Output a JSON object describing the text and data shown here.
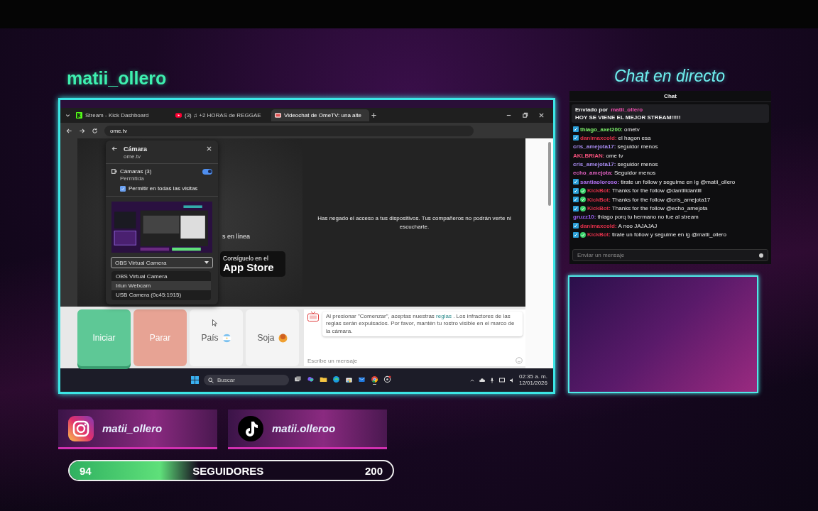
{
  "overlay": {
    "channel_name": "matii_ollero",
    "chat_heading": "Chat en directo"
  },
  "browser": {
    "tabs": [
      {
        "kind": "kick",
        "label": "Stream - Kick Dashboard",
        "selected": false
      },
      {
        "kind": "youtube",
        "label": "(3) ♫ +2 HORAS de REGGAE",
        "selected": false
      },
      {
        "kind": "ometv",
        "label": "Videochat de OmeTV: una alte",
        "selected": true
      }
    ],
    "address": "ome.tv",
    "page": {
      "online_text": "s en línea",
      "store_top": "Consíguelo en el",
      "store_name": "App Store",
      "denied_message": "Has negado el acceso a tus dispositivos. Tus compañeros no podrán verte ni escucharte.",
      "buttons": [
        {
          "kind": "start",
          "label": "Iniciar"
        },
        {
          "kind": "stop",
          "label": "Parar"
        },
        {
          "kind": "country",
          "label": "País"
        },
        {
          "kind": "gender",
          "label": "Soja"
        }
      ],
      "notice": {
        "before": "Al presionar \"Comenzar\", aceptas nuestras",
        "link": "reglas",
        "after": ". Los infractores de las reglas serán expulsados. Por favor, mantén tu rostro visible en el marco de la cámara."
      },
      "message_placeholder": "Escribe un mensaje"
    },
    "camera_popup": {
      "title": "Cámara",
      "site": "ome.tv",
      "permission_label": "Cámaras (3)",
      "permission_status": "Permitida",
      "on": true,
      "always_allow": {
        "label": "Permitir en todas las visitas",
        "checked": true
      },
      "select_value": "OBS Virtual Camera",
      "options": [
        {
          "label": "OBS Virtual Camera",
          "selected": false
        },
        {
          "label": "Iriun Webcam",
          "selected": true
        },
        {
          "label": "USB Camera (0c45:1915)",
          "selected": false
        }
      ]
    },
    "taskbar": {
      "search_placeholder": "Buscar",
      "apps": [
        {
          "kind": "taskview",
          "active": false
        },
        {
          "kind": "copilot",
          "active": false
        },
        {
          "kind": "files",
          "active": false
        },
        {
          "kind": "edge",
          "active": false
        },
        {
          "kind": "store",
          "active": false
        },
        {
          "kind": "mail",
          "active": false
        },
        {
          "kind": "chrome",
          "active": true
        },
        {
          "kind": "obs",
          "active": false
        }
      ],
      "time": "02:35 a. m.",
      "date": "12/01/2026"
    }
  },
  "chat": {
    "title": "Chat",
    "pinned": {
      "label": "Enviado por",
      "author": "matii_ollero",
      "text": "HOY SE VIENE EL MEJOR STREAM!!!!!"
    },
    "messages": [
      {
        "mod": true,
        "verified": false,
        "user": "thiago_axel200:",
        "color": "#7cf06a",
        "text": "ometv"
      },
      {
        "mod": true,
        "verified": false,
        "user": "danimaxcold:",
        "color": "#e0304a",
        "text": "el hagon esa"
      },
      {
        "mod": false,
        "verified": false,
        "user": "cris_amejota17:",
        "color": "#a88cf0",
        "text": "seguidor menos"
      },
      {
        "mod": false,
        "verified": false,
        "user": "AKLBRIAN:",
        "color": "#f0507a",
        "text": "ome tv"
      },
      {
        "mod": false,
        "verified": false,
        "user": "cris_amejota17:",
        "color": "#a88cf0",
        "text": "seguidor menos"
      },
      {
        "mod": false,
        "verified": false,
        "user": "echo_amejota:",
        "color": "#e060c0",
        "text": "Seguidor menos"
      },
      {
        "mod": true,
        "verified": false,
        "user": "santiaoloroso:",
        "color": "#b070f0",
        "text": "tirate un follow y seguime en ig @matii_ollero"
      },
      {
        "mod": true,
        "verified": true,
        "user": "KickBot:",
        "color": "#e0304a",
        "text": "Thanks for the follow @dantilldantill"
      },
      {
        "mod": true,
        "verified": true,
        "user": "KickBot:",
        "color": "#e0304a",
        "text": "Thanks for the follow @cris_amejota17"
      },
      {
        "mod": true,
        "verified": true,
        "user": "KickBot:",
        "color": "#e0304a",
        "text": "Thanks for the follow @echo_amejota"
      },
      {
        "mod": false,
        "verified": false,
        "user": "gruzz10:",
        "color": "#9a60f0",
        "text": "thiago porq tu hermano no fue al stream"
      },
      {
        "mod": true,
        "verified": false,
        "user": "danimaxcold:",
        "color": "#e0304a",
        "text": "A noo JAJAJAJ"
      },
      {
        "mod": true,
        "verified": true,
        "user": "KickBot:",
        "color": "#e0304a",
        "text": "tirate un follow y seguime en ig @matii_ollero"
      }
    ],
    "input_placeholder": "Enviar un mensaje"
  },
  "socials": [
    {
      "kind": "instagram",
      "handle": "matii_ollero"
    },
    {
      "kind": "tiktok",
      "handle": "matii.olleroo"
    }
  ],
  "follower_goal": {
    "current": "94",
    "label": "SEGUIDORES",
    "target": "200",
    "level": 0.4
  }
}
